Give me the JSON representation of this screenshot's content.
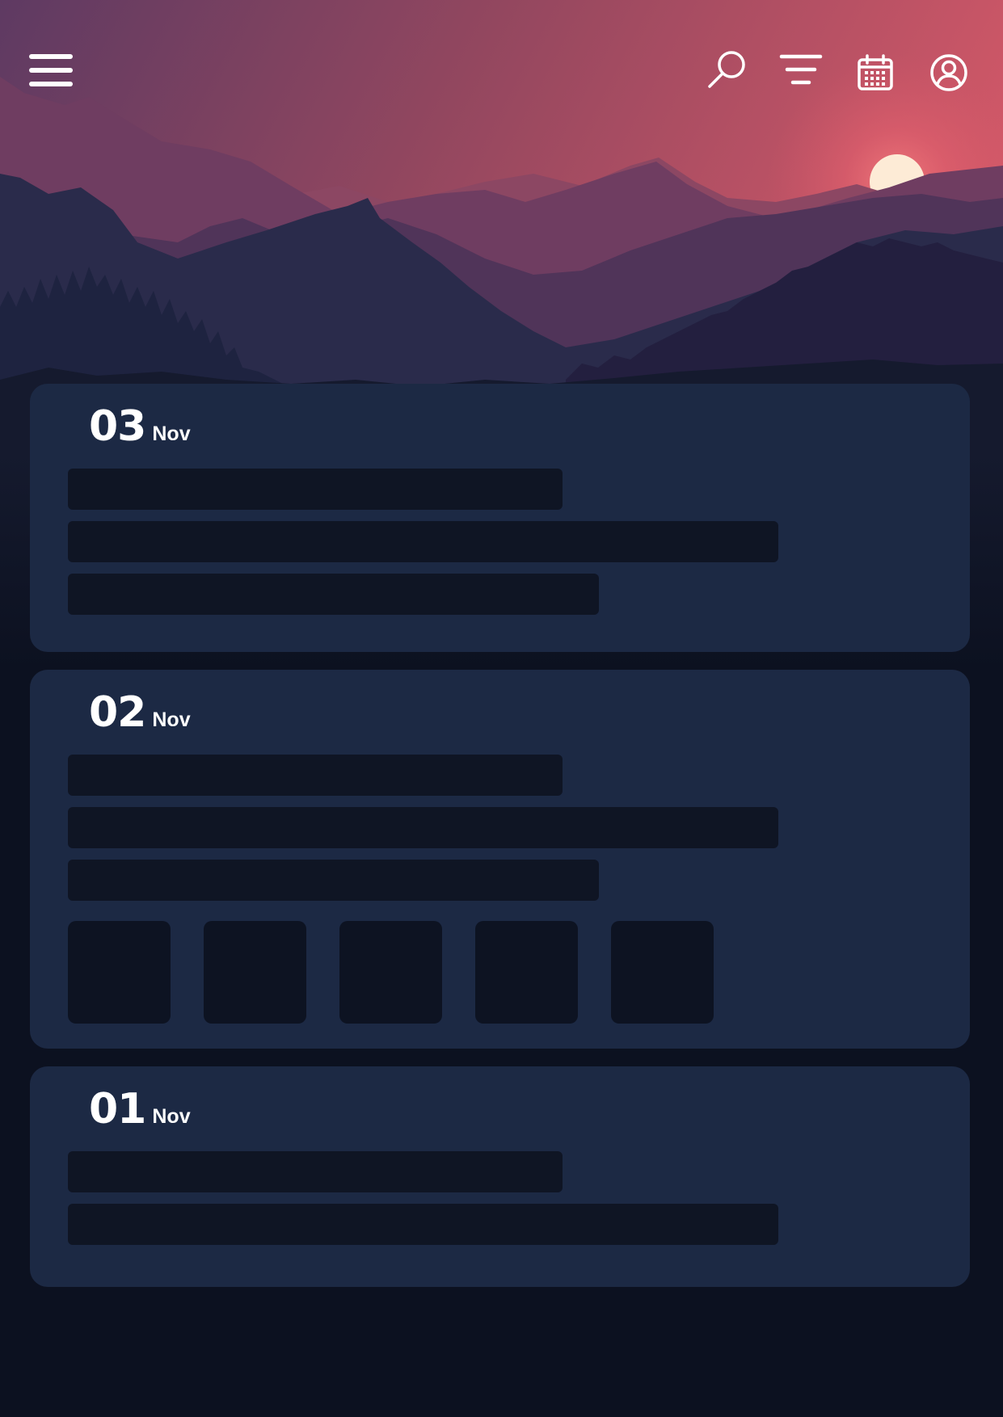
{
  "header": {
    "menu_icon": "hamburger-menu-icon",
    "search_icon": "search-icon",
    "filter_icon": "filter-icon",
    "calendar_icon": "calendar-icon",
    "profile_icon": "user-profile-icon",
    "icon_color": "#ffffff"
  },
  "colors": {
    "sky_top": "#6a4066",
    "sky_sunset": "#d85c6c",
    "sun": "#fde8d2",
    "card_background": "#1c2944",
    "placeholder": "#0f1524",
    "page_background": "#0c1120"
  },
  "entries": [
    {
      "day": "03",
      "month": "Nov",
      "text_placeholders": 3,
      "image_placeholders": 0
    },
    {
      "day": "02",
      "month": "Nov",
      "text_placeholders": 3,
      "image_placeholders": 5
    },
    {
      "day": "01",
      "month": "Nov",
      "text_placeholders": 2,
      "image_placeholders": 0
    }
  ]
}
